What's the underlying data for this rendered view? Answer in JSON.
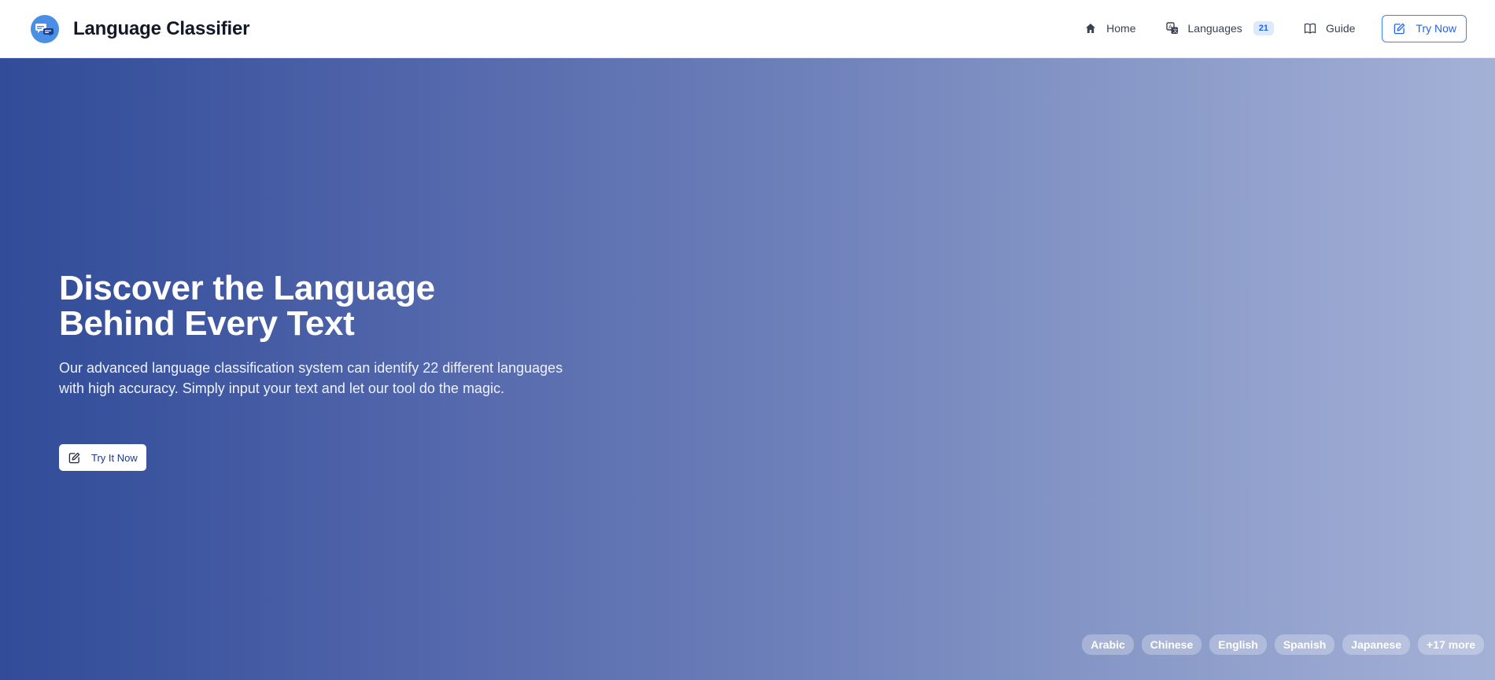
{
  "header": {
    "title": "Language Classifier",
    "logo_icon": "chat-bubbles-icon",
    "nav": [
      {
        "label": "Home",
        "icon": "home-icon"
      },
      {
        "label": "Languages",
        "icon": "translate-icon",
        "badge": "21"
      },
      {
        "label": "Guide",
        "icon": "book-icon"
      }
    ],
    "cta_label": "Try Now"
  },
  "hero": {
    "title_line1": "Discover the Language",
    "title_line2": "Behind Every Text",
    "description": "Our advanced language classification system can identify 22 different languages with high accuracy. Simply input your text and let our tool do the magic.",
    "button_label": "Try It Now",
    "language_tags": [
      "Arabic",
      "Chinese",
      "English",
      "Spanish",
      "Japanese",
      "+17 more"
    ]
  },
  "colors": {
    "accent": "#3b82f6",
    "hero_gradient_start": "#324c99",
    "hero_gradient_end": "#a4b1d7"
  }
}
